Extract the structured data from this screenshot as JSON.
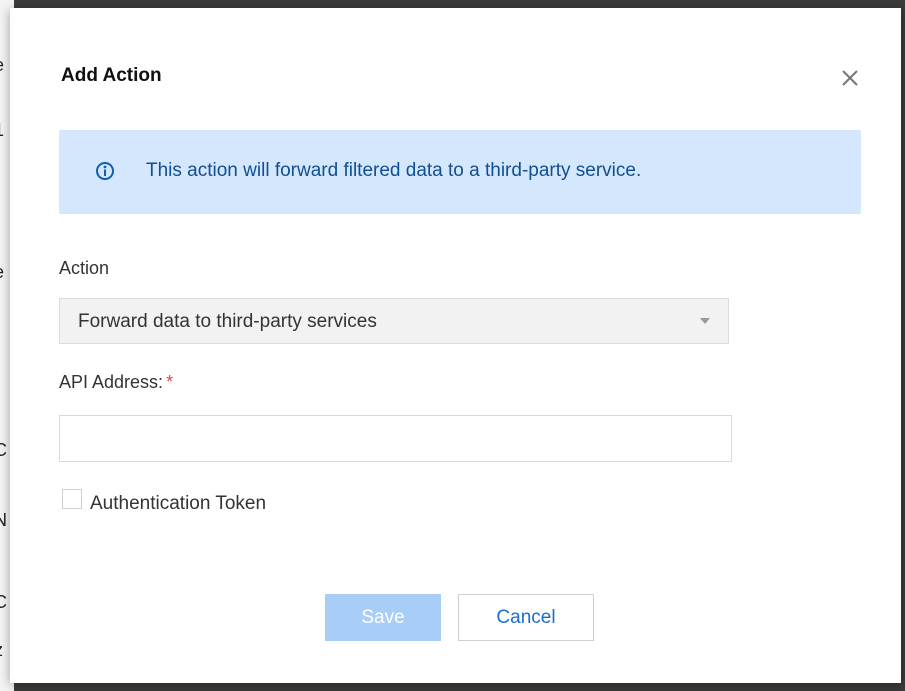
{
  "dialog": {
    "title": "Add Action",
    "close_icon": "close-icon"
  },
  "info_banner": {
    "icon": "info-icon",
    "text": "This action will forward filtered data to a third-party service."
  },
  "action_field": {
    "label": "Action",
    "selected_value": "Forward data to third-party services",
    "caret_icon": "caret-down-icon"
  },
  "api_field": {
    "label": "API Address:",
    "required_marker": "*",
    "value": "",
    "placeholder": ""
  },
  "auth_token": {
    "label": "Authentication Token",
    "checked": false
  },
  "buttons": {
    "save_label": "Save",
    "cancel_label": "Cancel"
  },
  "colors": {
    "banner_bg": "#d5e7fd",
    "banner_text": "#0f4f92",
    "save_disabled": "#a8cdf7",
    "cancel_text": "#1a6fc9",
    "required": "#e54545"
  }
}
